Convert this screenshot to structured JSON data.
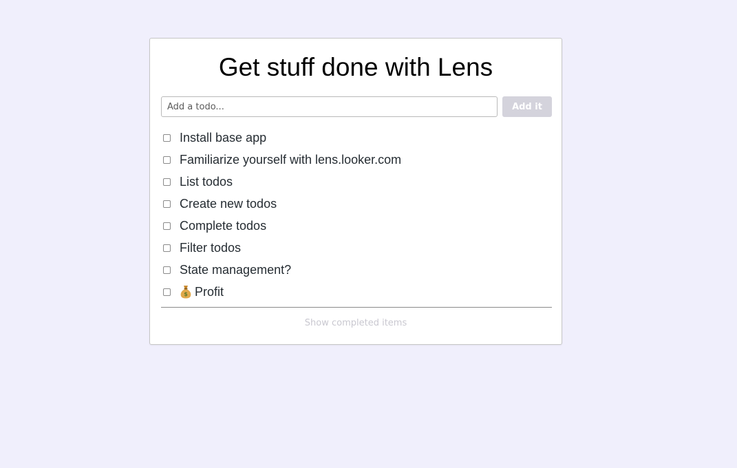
{
  "app": {
    "title": "Get stuff done with Lens"
  },
  "new_todo": {
    "placeholder": "Add a todo...",
    "value": "",
    "add_label": "Add it"
  },
  "todos": [
    {
      "label": "Install base app",
      "completed": false
    },
    {
      "label": "Familiarize yourself with lens.looker.com",
      "completed": false
    },
    {
      "label": "List todos",
      "completed": false
    },
    {
      "label": "Create new todos",
      "completed": false
    },
    {
      "label": "Complete todos",
      "completed": false
    },
    {
      "label": "Filter todos",
      "completed": false
    },
    {
      "label": "State management?",
      "completed": false
    },
    {
      "label": "Profit",
      "completed": false,
      "icon": "money-bag-icon"
    }
  ],
  "footer": {
    "show_completed_label": "Show completed items"
  },
  "colors": {
    "background": "#f0effc",
    "button_disabled": "#d4d3dc",
    "muted_text": "#c9c8d0"
  }
}
